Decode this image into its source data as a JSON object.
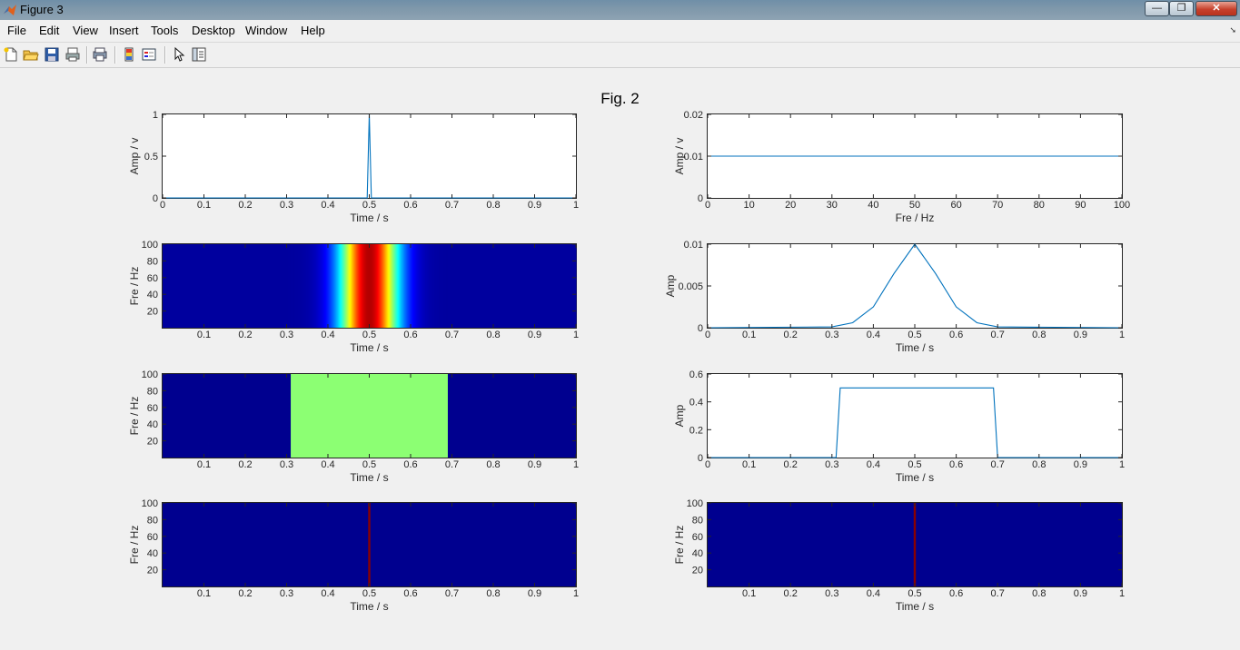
{
  "window": {
    "title": "Figure 3",
    "minimize": "—",
    "restore": "❐",
    "close": "✕"
  },
  "menu": [
    "File",
    "Edit",
    "View",
    "Insert",
    "Tools",
    "Desktop",
    "Window",
    "Help"
  ],
  "toolbar": [
    "new-figure",
    "open-file",
    "save-figure",
    "print-figure",
    "print-preview",
    "insert-colorbar",
    "insert-legend",
    "edit-plot",
    "show-plot-tools"
  ],
  "figure_title": "Fig. 2",
  "chart_data": [
    {
      "id": "p1",
      "type": "line",
      "xlabel": "Time / s",
      "ylabel": "Amp / v",
      "xlim": [
        0,
        1
      ],
      "ylim": [
        0,
        1
      ],
      "xticks": [
        "0",
        "0.1",
        "0.2",
        "0.3",
        "0.4",
        "0.5",
        "0.6",
        "0.7",
        "0.8",
        "0.9",
        "1"
      ],
      "yticks": [
        "0",
        "0.5",
        "1"
      ],
      "x": [
        0,
        0.495,
        0.5,
        0.505,
        1
      ],
      "y": [
        0,
        0,
        1,
        0,
        0
      ],
      "color": "#0072bd"
    },
    {
      "id": "p2",
      "type": "line",
      "xlabel": "Fre / Hz",
      "ylabel": "Amp / v",
      "xlim": [
        0,
        100
      ],
      "ylim": [
        0,
        0.02
      ],
      "xticks": [
        "0",
        "10",
        "20",
        "30",
        "40",
        "50",
        "60",
        "70",
        "80",
        "90",
        "100"
      ],
      "yticks": [
        "0",
        "0.01",
        "0.02"
      ],
      "x": [
        0,
        100
      ],
      "y": [
        0.01,
        0.01
      ],
      "color": "#0072bd"
    },
    {
      "id": "p3",
      "type": "heatmap",
      "xlabel": "Time / s",
      "ylabel": "Fre / Hz",
      "xlim": [
        0,
        1
      ],
      "ylim": [
        0,
        100
      ],
      "xticks": [
        "0.1",
        "0.2",
        "0.3",
        "0.4",
        "0.5",
        "0.6",
        "0.7",
        "0.8",
        "0.9",
        "1"
      ],
      "yticks": [
        "20",
        "40",
        "60",
        "80",
        "100"
      ],
      "pattern": "gaussian-in-time",
      "center": 0.5,
      "sigma": 0.05
    },
    {
      "id": "p4",
      "type": "line",
      "xlabel": "Time / s",
      "ylabel": "Amp",
      "xlim": [
        0,
        1
      ],
      "ylim": [
        0,
        0.01
      ],
      "xticks": [
        "0",
        "0.1",
        "0.2",
        "0.3",
        "0.4",
        "0.5",
        "0.6",
        "0.7",
        "0.8",
        "0.9",
        "1"
      ],
      "yticks": [
        "0",
        "0.005",
        "0.01"
      ],
      "x": [
        0,
        0.3,
        0.35,
        0.4,
        0.45,
        0.5,
        0.55,
        0.6,
        0.65,
        0.7,
        1
      ],
      "y": [
        0,
        0.0001,
        0.0006,
        0.0025,
        0.0065,
        0.01,
        0.0065,
        0.0025,
        0.0006,
        0.0001,
        0
      ],
      "color": "#0072bd"
    },
    {
      "id": "p5",
      "type": "heatmap",
      "xlabel": "Time / s",
      "ylabel": "Fre / Hz",
      "xlim": [
        0,
        1
      ],
      "ylim": [
        0,
        100
      ],
      "xticks": [
        "0.1",
        "0.2",
        "0.3",
        "0.4",
        "0.5",
        "0.6",
        "0.7",
        "0.8",
        "0.9",
        "1"
      ],
      "yticks": [
        "20",
        "40",
        "60",
        "80",
        "100"
      ],
      "pattern": "box-in-time",
      "start": 0.31,
      "end": 0.69,
      "color": "#8cff73"
    },
    {
      "id": "p6",
      "type": "line",
      "xlabel": "Time / s",
      "ylabel": "Amp",
      "xlim": [
        0,
        1
      ],
      "ylim": [
        0,
        0.6
      ],
      "xticks": [
        "0",
        "0.1",
        "0.2",
        "0.3",
        "0.4",
        "0.5",
        "0.6",
        "0.7",
        "0.8",
        "0.9",
        "1"
      ],
      "yticks": [
        "0",
        "0.2",
        "0.4",
        "0.6"
      ],
      "x": [
        0,
        0.31,
        0.32,
        0.69,
        0.7,
        1
      ],
      "y": [
        0,
        0,
        0.5,
        0.5,
        0,
        0
      ],
      "color": "#0072bd"
    },
    {
      "id": "p7",
      "type": "heatmap",
      "xlabel": "Time / s",
      "ylabel": "Fre / Hz",
      "xlim": [
        0,
        1
      ],
      "ylim": [
        0,
        100
      ],
      "xticks": [
        "0.1",
        "0.2",
        "0.3",
        "0.4",
        "0.5",
        "0.6",
        "0.7",
        "0.8",
        "0.9",
        "1"
      ],
      "yticks": [
        "20",
        "40",
        "60",
        "80",
        "100"
      ],
      "pattern": "impulse-in-time",
      "center": 0.5
    },
    {
      "id": "p8",
      "type": "heatmap",
      "xlabel": "Time / s",
      "ylabel": "Fre / Hz",
      "xlim": [
        0,
        1
      ],
      "ylim": [
        0,
        100
      ],
      "xticks": [
        "0.1",
        "0.2",
        "0.3",
        "0.4",
        "0.5",
        "0.6",
        "0.7",
        "0.8",
        "0.9",
        "1"
      ],
      "yticks": [
        "20",
        "40",
        "60",
        "80",
        "100"
      ],
      "pattern": "impulse-in-time",
      "center": 0.5
    }
  ]
}
